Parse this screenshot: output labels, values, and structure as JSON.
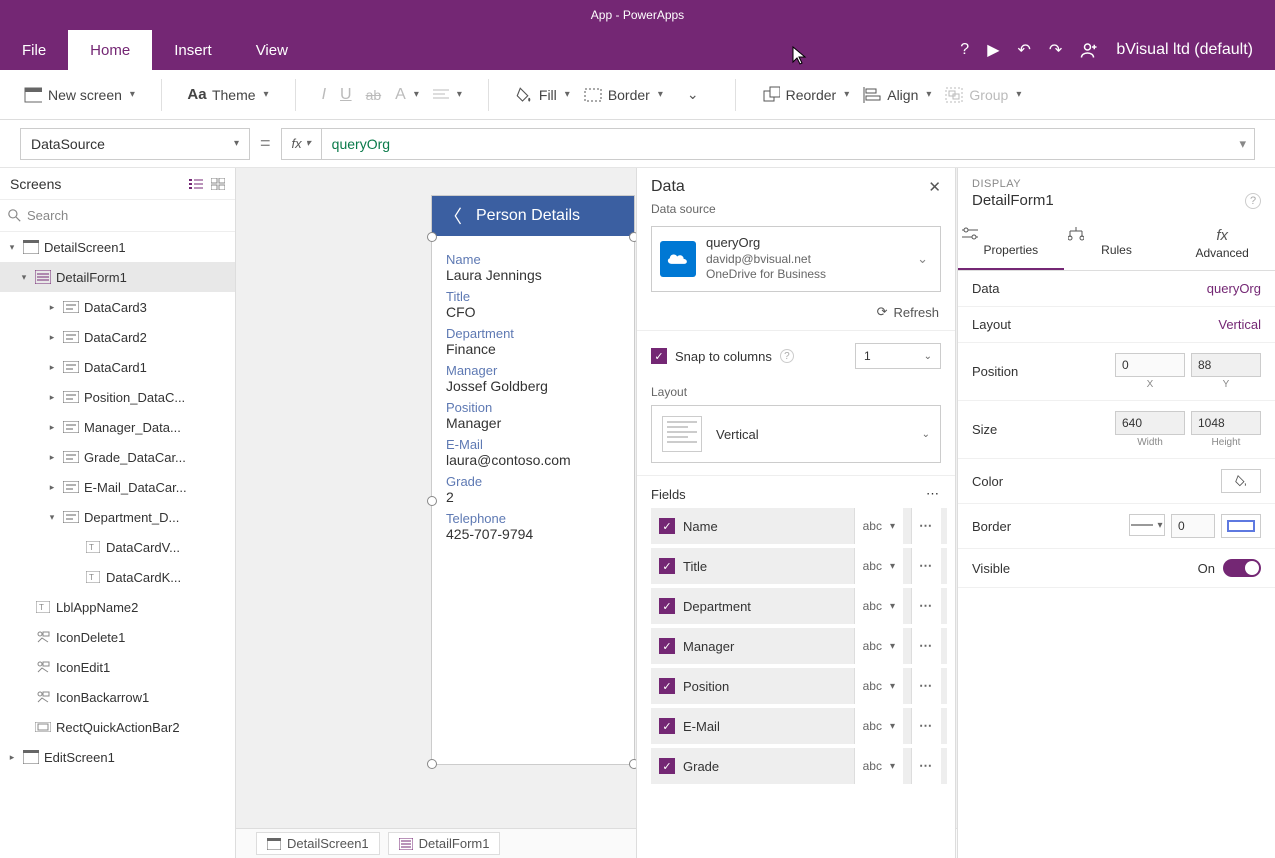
{
  "title": "App - PowerApps",
  "menu": {
    "file": "File",
    "home": "Home",
    "insert": "Insert",
    "view": "View",
    "account": "bVisual ltd (default)"
  },
  "ribbon": {
    "newscreen": "New screen",
    "theme": "Theme",
    "fill": "Fill",
    "border": "Border",
    "reorder": "Reorder",
    "align": "Align",
    "group": "Group"
  },
  "formula": {
    "property": "DataSource",
    "fx": "fx",
    "value": "queryOrg"
  },
  "tree": {
    "title": "Screens",
    "search_ph": "Search",
    "items": [
      {
        "lvl": 0,
        "arrow": "▾",
        "icon": "screen",
        "label": "DetailScreen1",
        "sel": false
      },
      {
        "lvl": 1,
        "arrow": "▾",
        "icon": "form",
        "label": "DetailForm1",
        "sel": true
      },
      {
        "lvl": 2,
        "arrow": "▸",
        "icon": "card",
        "label": "DataCard3"
      },
      {
        "lvl": 2,
        "arrow": "▸",
        "icon": "card",
        "label": "DataCard2"
      },
      {
        "lvl": 2,
        "arrow": "▸",
        "icon": "card",
        "label": "DataCard1"
      },
      {
        "lvl": 2,
        "arrow": "▸",
        "icon": "card",
        "label": "Position_DataC..."
      },
      {
        "lvl": 2,
        "arrow": "▸",
        "icon": "card",
        "label": "Manager_Data..."
      },
      {
        "lvl": 2,
        "arrow": "▸",
        "icon": "card",
        "label": "Grade_DataCar..."
      },
      {
        "lvl": 2,
        "arrow": "▸",
        "icon": "card",
        "label": "E-Mail_DataCar..."
      },
      {
        "lvl": 2,
        "arrow": "▾",
        "icon": "card",
        "label": "Department_D..."
      },
      {
        "lvl": 3,
        "arrow": "",
        "icon": "txt",
        "label": "DataCardV..."
      },
      {
        "lvl": 3,
        "arrow": "",
        "icon": "txt",
        "label": "DataCardK..."
      },
      {
        "lvl": 1,
        "arrow": "",
        "icon": "txt",
        "label": "LblAppName2"
      },
      {
        "lvl": 1,
        "arrow": "",
        "icon": "iconx",
        "label": "IconDelete1"
      },
      {
        "lvl": 1,
        "arrow": "",
        "icon": "iconx",
        "label": "IconEdit1"
      },
      {
        "lvl": 1,
        "arrow": "",
        "icon": "iconx",
        "label": "IconBackarrow1"
      },
      {
        "lvl": 1,
        "arrow": "",
        "icon": "rect",
        "label": "RectQuickActionBar2"
      },
      {
        "lvl": 0,
        "arrow": "▸",
        "icon": "screen",
        "label": "EditScreen1"
      }
    ]
  },
  "crumbs": [
    "DetailScreen1",
    "DetailForm1"
  ],
  "phone": {
    "header": "Person Details",
    "fields": [
      {
        "label": "Name",
        "value": "Laura Jennings"
      },
      {
        "label": "Title",
        "value": "CFO"
      },
      {
        "label": "Department",
        "value": "Finance"
      },
      {
        "label": "Manager",
        "value": "Jossef Goldberg"
      },
      {
        "label": "Position",
        "value": "Manager"
      },
      {
        "label": "E-Mail",
        "value": "laura@contoso.com"
      },
      {
        "label": "Grade",
        "value": "2"
      },
      {
        "label": "Telephone",
        "value": "425-707-9794"
      }
    ]
  },
  "datapane": {
    "title": "Data",
    "ds_label": "Data source",
    "ds_name": "queryOrg",
    "ds_sub1": "davidp@bvisual.net",
    "ds_sub2": "OneDrive for Business",
    "refresh": "Refresh",
    "snap": "Snap to columns",
    "snap_val": "1",
    "layout_label": "Layout",
    "layout_val": "Vertical",
    "fields_label": "Fields",
    "fields": [
      "Name",
      "Title",
      "Department",
      "Manager",
      "Position",
      "E-Mail",
      "Grade"
    ],
    "ftype": "abc"
  },
  "props": {
    "display": "DISPLAY",
    "elname": "DetailForm1",
    "tabs": {
      "properties": "Properties",
      "rules": "Rules",
      "advanced": "Advanced"
    },
    "data_label": "Data",
    "data_val": "queryOrg",
    "layout_label": "Layout",
    "layout_val": "Vertical",
    "position_label": "Position",
    "pos_x": "0",
    "pos_y": "88",
    "x": "X",
    "y": "Y",
    "size_label": "Size",
    "size_w": "640",
    "size_h": "1048",
    "wl": "Width",
    "hl": "Height",
    "color_label": "Color",
    "border_label": "Border",
    "border_val": "0",
    "visible_label": "Visible",
    "visible_val": "On"
  }
}
